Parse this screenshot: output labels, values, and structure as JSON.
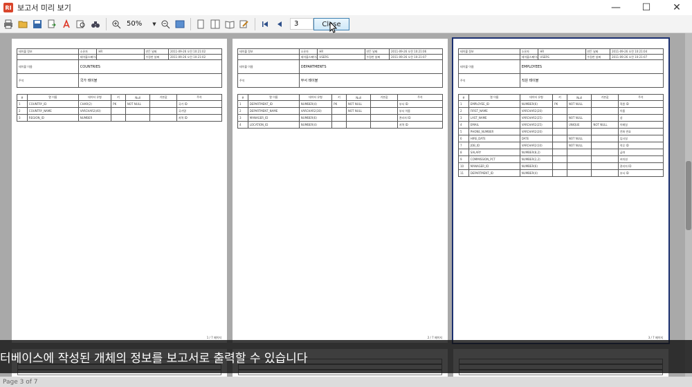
{
  "window": {
    "title": "보고서 미리 보기",
    "minimize": "—",
    "maximize": "☐",
    "close": "✕"
  },
  "toolbar": {
    "zoom_value": "50%",
    "page_value": "3",
    "close_button": "Close",
    "icons": [
      "print-icon",
      "open-icon",
      "save-icon",
      "export-icon",
      "pdf-icon",
      "find-icon",
      "binoculars-icon",
      "zoom-in-icon",
      "zoom-out-icon",
      "one-page-icon",
      "two-page-icon",
      "multi-page-icon",
      "book-icon",
      "edit-icon",
      "first-page-icon",
      "prev-page-icon",
      "next-page-icon",
      "last-page-icon"
    ]
  },
  "pages": [
    {
      "meta": {
        "l1": "테이블 정보",
        "owner_label": "소유자",
        "owner": "HR",
        "created_label": "만든 날짜",
        "created": "2011-09-26 오전 10:21:02",
        "ts_label": "테이블스페이스",
        "ts": "",
        "modified_label": "수정한 날짜",
        "modified": "2011-09-26 오전 10:21:02",
        "name_label": "테이블 이름",
        "name": "COUNTRIES",
        "desc_label": "주석",
        "desc": "국가 테이블"
      },
      "headers": [
        "#",
        "열 이름",
        "데이터 유형",
        "키",
        "Null",
        "기본값",
        "주석"
      ],
      "rows": [
        [
          "1",
          "COUNTRY_ID",
          "CHAR(2)",
          "PK",
          "NOT NULL",
          "",
          "국가 ID"
        ],
        [
          "2",
          "COUNTRY_NAME",
          "VARCHAR2(40)",
          "",
          "",
          "",
          "국가명"
        ],
        [
          "3",
          "REGION_ID",
          "NUMBER",
          "",
          "",
          "",
          "지역 ID"
        ]
      ],
      "footer": "1 / 7 페이지"
    },
    {
      "meta": {
        "l1": "테이블 정보",
        "owner_label": "소유자",
        "owner": "HR",
        "created_label": "만든 날짜",
        "created": "2011-09-26 오전 10:21:06",
        "ts_label": "테이블스페이스",
        "ts": "USERS",
        "modified_label": "수정한 날짜",
        "modified": "2011-09-26 오전 10:21:07",
        "name_label": "테이블 이름",
        "name": "DEPARTMENTS",
        "desc_label": "주석",
        "desc": "부서 테이블"
      },
      "headers": [
        "#",
        "열 이름",
        "데이터 유형",
        "키",
        "Null",
        "기본값",
        "주석"
      ],
      "rows": [
        [
          "1",
          "DEPARTMENT_ID",
          "NUMBER(4)",
          "PK",
          "NOT NULL",
          "",
          "부서 ID"
        ],
        [
          "2",
          "DEPARTMENT_NAME",
          "VARCHAR2(30)",
          "",
          "NOT NULL",
          "",
          "부서 이름"
        ],
        [
          "3",
          "MANAGER_ID",
          "NUMBER(6)",
          "",
          "",
          "",
          "관리자 ID"
        ],
        [
          "4",
          "LOCATION_ID",
          "NUMBER(4)",
          "",
          "",
          "",
          "지역 ID"
        ]
      ],
      "footer": "2 / 7 페이지"
    },
    {
      "meta": {
        "l1": "테이블 정보",
        "owner_label": "소유자",
        "owner": "HR",
        "created_label": "만든 날짜",
        "created": "2011-09-26 오전 10:21:04",
        "ts_label": "테이블스페이스",
        "ts": "USERS",
        "modified_label": "수정한 날짜",
        "modified": "2011-09-26 오전 10:21:07",
        "name_label": "테이블 이름",
        "name": "EMPLOYEES",
        "desc_label": "주석",
        "desc": "직원 테이블"
      },
      "headers": [
        "#",
        "열 이름",
        "데이터 유형",
        "키",
        "Null",
        "기본값",
        "주석"
      ],
      "rows": [
        [
          "1",
          "EMPLOYEE_ID",
          "NUMBER(6)",
          "PK",
          "NOT NULL",
          "",
          "직원 ID"
        ],
        [
          "2",
          "FIRST_NAME",
          "VARCHAR2(20)",
          "",
          "",
          "",
          "이름"
        ],
        [
          "3",
          "LAST_NAME",
          "VARCHAR2(25)",
          "",
          "NOT NULL",
          "",
          "성"
        ],
        [
          "4",
          "EMAIL",
          "VARCHAR2(25)",
          "",
          "UNIQUE",
          "NOT NULL",
          "이메일"
        ],
        [
          "5",
          "PHONE_NUMBER",
          "VARCHAR2(20)",
          "",
          "",
          "",
          "전화 번호"
        ],
        [
          "6",
          "HIRE_DATE",
          "DATE",
          "",
          "NOT NULL",
          "",
          "입사일"
        ],
        [
          "7",
          "JOB_ID",
          "VARCHAR2(10)",
          "",
          "NOT NULL",
          "",
          "직무 ID"
        ],
        [
          "8",
          "SALARY",
          "NUMBER(8,2)",
          "",
          "",
          "",
          "급여"
        ],
        [
          "9",
          "COMMISSION_PCT",
          "NUMBER(2,2)",
          "",
          "",
          "",
          "커미션"
        ],
        [
          "10",
          "MANAGER_ID",
          "NUMBER(6)",
          "",
          "",
          "",
          "관리자 ID"
        ],
        [
          "11",
          "DEPARTMENT_ID",
          "NUMBER(4)",
          "",
          "",
          "",
          "부서 ID"
        ]
      ],
      "footer": "3 / 7 페이지"
    }
  ],
  "caption": "터베이스에 작성된 개체의 정보를 보고서로 출력할 수 있습니다",
  "status": "Page 3 of 7"
}
